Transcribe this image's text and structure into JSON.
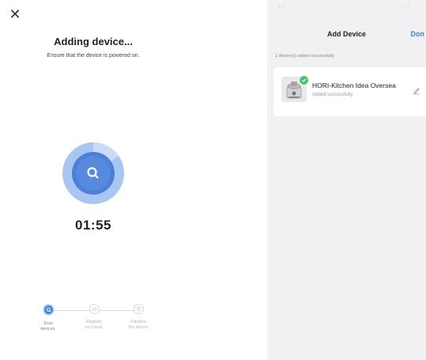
{
  "left_panel": {
    "close_icon": "✕",
    "title": "Adding device...",
    "subtitle": "Ensure that the device is powered on.",
    "timer": "01:55",
    "steps": [
      {
        "label": "Scan\ndevices.",
        "state": "active",
        "icon": "search-icon"
      },
      {
        "label": "Register\non Cloud.",
        "state": "idle",
        "icon": "cloud-icon"
      },
      {
        "label": "Initialize\nthe device",
        "state": "idle",
        "icon": "device-icon"
      }
    ]
  },
  "right_panel": {
    "nav_title": "Add Device",
    "done_label": "Don",
    "added_count": "1 device(s) added successfully",
    "device": {
      "name": "HORI-Kitchen Idea Oversea",
      "status": "Added successfully"
    }
  },
  "colors": {
    "accent": "#4a7ed8",
    "success": "#4cc36a",
    "link": "#3a82e0"
  }
}
